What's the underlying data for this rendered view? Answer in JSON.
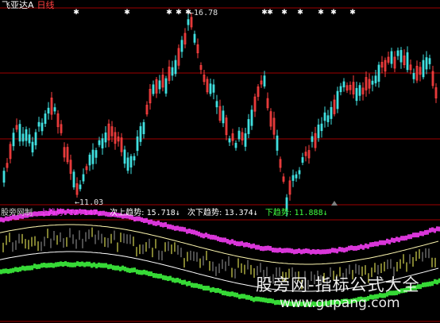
{
  "header": {
    "stock_name": "飞亚达A",
    "period": "日线"
  },
  "price_markers": {
    "high": "16.78",
    "low": "11.03"
  },
  "indicator": {
    "name": "股旁网制",
    "items": [
      {
        "label": "上趋势:",
        "value": "17.147↓",
        "color": "#ff40ff"
      },
      {
        "label": "次上趋势:",
        "value": "15.718↓",
        "color": "#ffffff"
      },
      {
        "label": "次下趋势:",
        "value": "13.374↓",
        "color": "#ffffff"
      },
      {
        "label": "下趋势:",
        "value": "11.888↓",
        "color": "#40ff40"
      }
    ]
  },
  "watermark": {
    "line1": "股旁网-指标公式大全",
    "line2": "www.gupang.com"
  },
  "colors": {
    "up_candle": "#ff4040",
    "down_candle": "#40e0e0",
    "grid_line": "#a00000",
    "upper_band": "#ff40ff",
    "lower_band": "#40ff40",
    "mid_band": "#ffff80"
  }
}
